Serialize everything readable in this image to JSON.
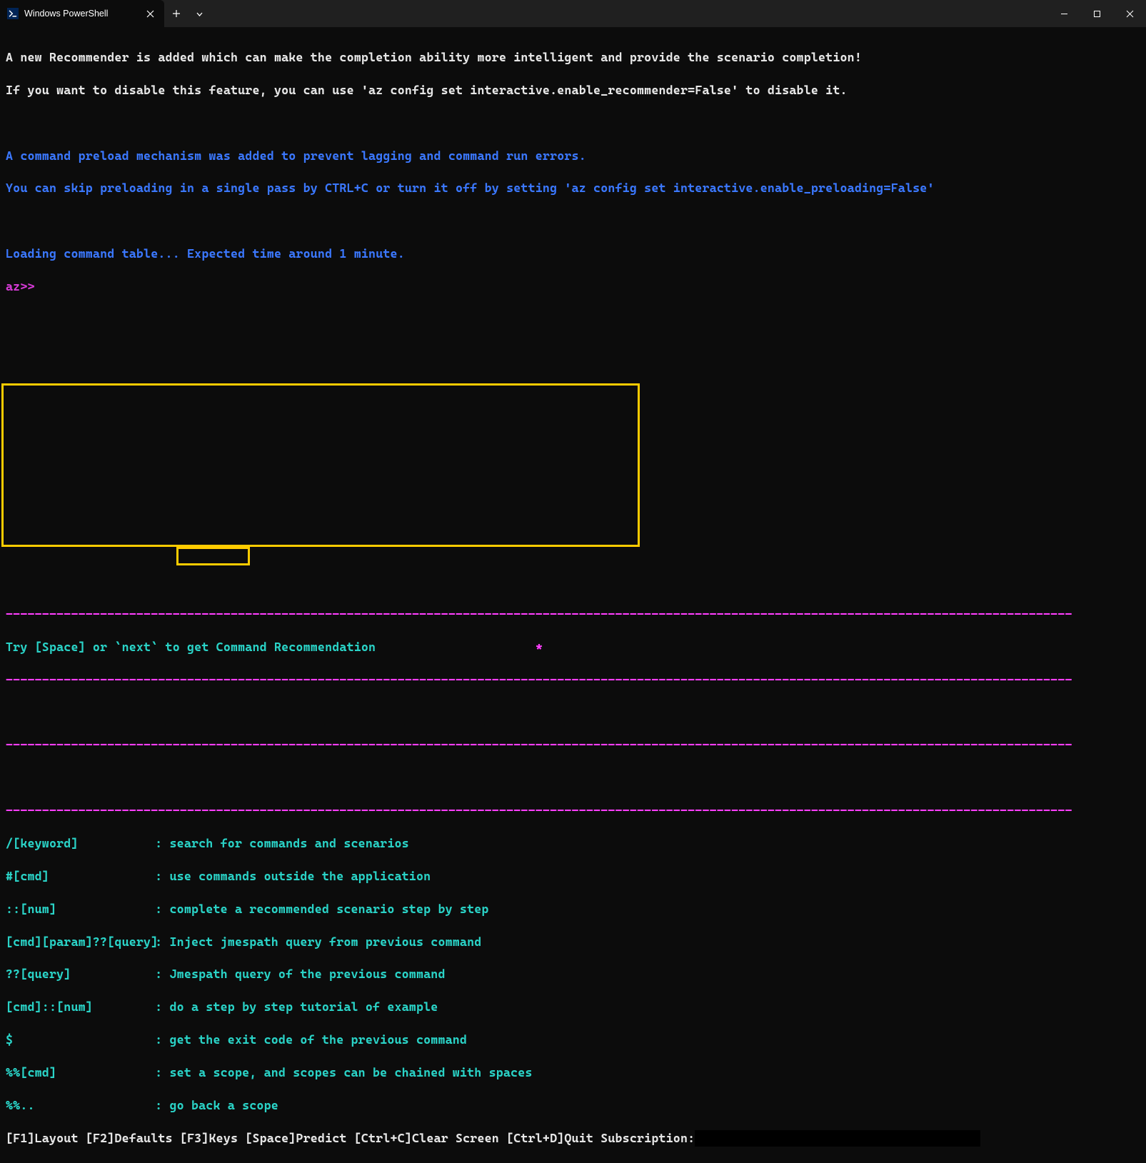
{
  "titlebar": {
    "tab_title": "Windows PowerShell"
  },
  "lines": {
    "l1": "A new Recommender is added which can make the completion ability more intelligent and provide the scenario completion!",
    "l2": "If you want to disable this feature, you can use 'az config set interactive.enable_recommender=False' to disable it.",
    "l3": "A command preload mechanism was added to prevent lagging and command run errors.",
    "l4": "You can skip preloading in a single pass by CTRL+C or turn it off by setting 'az config set interactive.enable_preloading=False'",
    "l5": "Loading command table... Expected time around 1 minute.",
    "prompt": "az>>"
  },
  "hint": {
    "text": "Try [Space] or `next` to get Command Recommendation",
    "star": "*"
  },
  "dashline": "---------------------------------------------------------------------------------------------------------------------------------------------------",
  "help": [
    {
      "key": "/[keyword]",
      "desc": ": search for commands and scenarios"
    },
    {
      "key": "#[cmd]",
      "desc": ": use commands outside the application"
    },
    {
      "key": "::[num]",
      "desc": ": complete a recommended scenario step by step"
    },
    {
      "key": "[cmd][param]??[query]",
      "desc": ": Inject jmespath query from previous command"
    },
    {
      "key": "??[query]",
      "desc": ": Jmespath query of the previous command"
    },
    {
      "key": "[cmd]::[num]",
      "desc": ": do a step by step tutorial of example"
    },
    {
      "key": "$",
      "desc": ": get the exit code of the previous command"
    },
    {
      "key": "%%[cmd]",
      "desc": ": set a scope, and scopes can be chained with spaces"
    },
    {
      "key": "%%..",
      "desc": ": go back a scope"
    }
  ],
  "statusbar": {
    "items": "[F1]Layout [F2]Defaults [F3]Keys [Space]Predict [Ctrl+C]Clear Screen [Ctrl+D]Quit Subscription:"
  }
}
